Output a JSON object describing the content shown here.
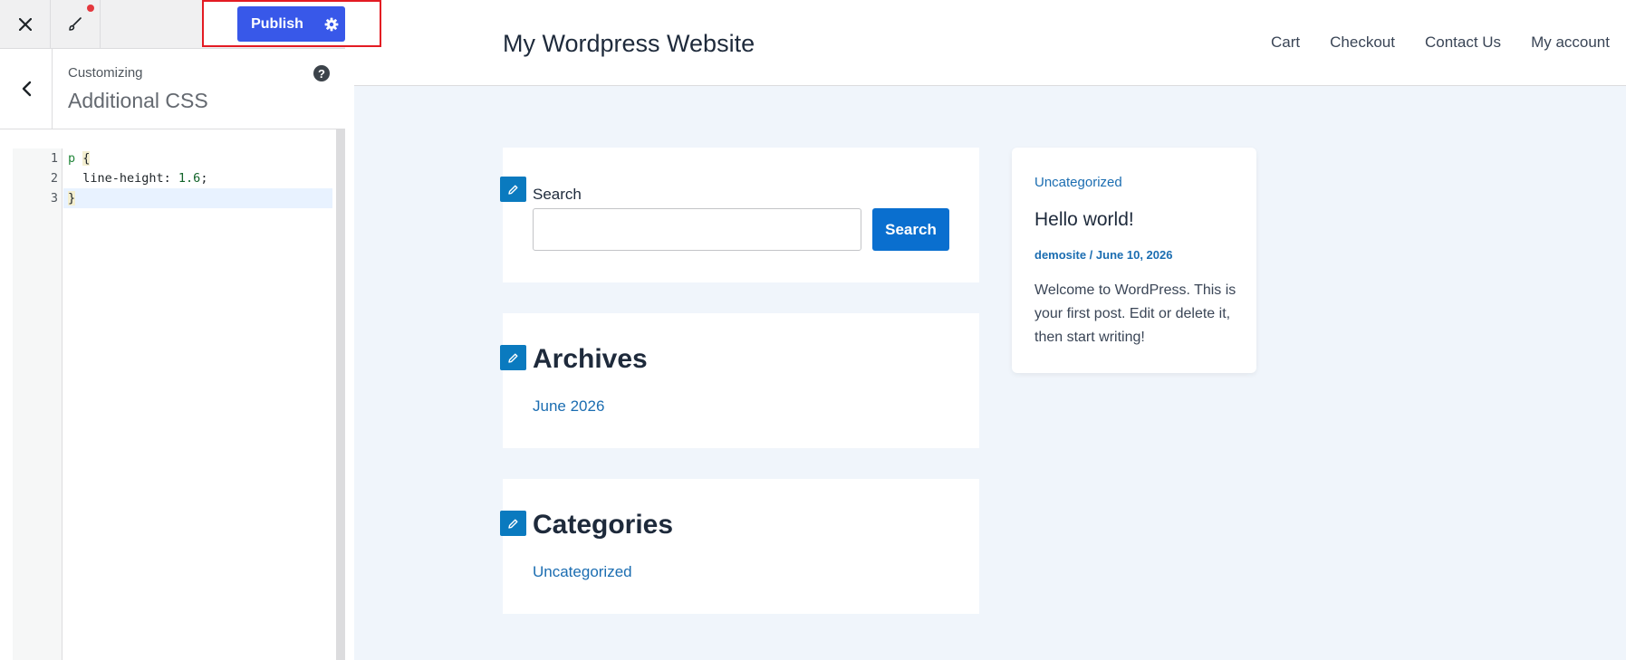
{
  "topbar": {
    "publish_label": "Publish"
  },
  "section": {
    "crumb": "Customizing",
    "title": "Additional CSS",
    "help_glyph": "?"
  },
  "editor": {
    "lines": [
      {
        "number": "1",
        "tag": "p",
        "rest": " ",
        "brace": "{"
      },
      {
        "number": "2",
        "text": "  line-height: ",
        "value": "1.6",
        "end": ";"
      },
      {
        "number": "3",
        "brace": "}"
      }
    ]
  },
  "site": {
    "title": "My Wordpress Website",
    "nav": [
      "Cart",
      "Checkout",
      "Contact Us",
      "My account"
    ]
  },
  "widgets": {
    "search": {
      "label": "Search",
      "button": "Search",
      "value": "",
      "placeholder": ""
    },
    "archives": {
      "title": "Archives",
      "link": "June 2026"
    },
    "categories": {
      "title": "Categories",
      "link": "Uncategorized"
    }
  },
  "post": {
    "category": "Uncategorized",
    "title": "Hello world!",
    "meta": "demosite / June 10, 2026",
    "excerpt": "Welcome to WordPress. This is your first post. Edit or delete it, then start writing!"
  },
  "colors": {
    "publish": "#3858e9",
    "highlight": "#e31b23",
    "link": "#1b6db1",
    "edit_pencil": "#0a7abf",
    "search_button": "#0a6fcf"
  },
  "icons": {
    "close": "close-icon",
    "brush": "brush-icon",
    "settings": "gear-icon",
    "back": "chevron-left-icon",
    "help": "help-icon",
    "edit": "pencil-icon"
  }
}
